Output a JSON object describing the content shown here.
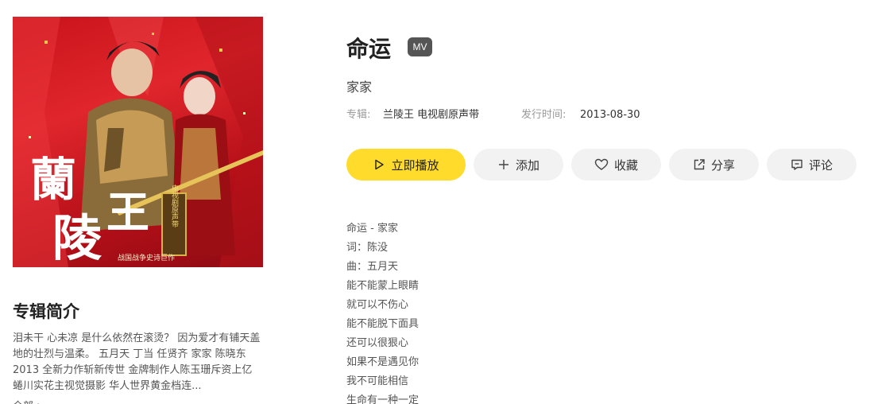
{
  "cover": {
    "title_chars": [
      "蘭",
      "陵",
      "王"
    ],
    "seal_text": "电视剧原声带",
    "tagline": "战国战争史诗巨作"
  },
  "intro": {
    "heading": "专辑简介",
    "text": "泪未干 心未凉 是什么依然在滚烫？ 因为爱才有铺天盖地的壮烈与温柔。 五月天 丁当 任贤齐 家家 陈晓东 2013 全新力作斩新传世 金牌制作人陈玉珊斥资上亿 蜷川实花主视觉摄影 华人世界黄金档连...",
    "more": "全部 >"
  },
  "song": {
    "title": "命运",
    "mv_badge": "MV",
    "singer": "家家",
    "album_label": "专辑:",
    "album": "兰陵王 电视剧原声带",
    "release_label": "发行时间:",
    "release_date": "2013-08-30"
  },
  "actions": {
    "play": "立即播放",
    "add": "添加",
    "favorite": "收藏",
    "share": "分享",
    "comment": "评论"
  },
  "colors": {
    "accent": "#ffdb2b",
    "button_bg": "#f2f2f2",
    "badge_bg": "#555555",
    "cover_red": "#d81e24"
  },
  "icons": {
    "play": "play-icon",
    "add": "plus-icon",
    "favorite": "heart-icon",
    "share": "share-icon",
    "comment": "comment-icon"
  },
  "lyrics": [
    "命运 - 家家",
    "词：陈没",
    "曲：五月天",
    "能不能蒙上眼睛",
    "就可以不伤心",
    "能不能脱下面具",
    "还可以很狠心",
    "如果不是遇见你",
    "我不可能相信",
    "生命有一种一定"
  ]
}
